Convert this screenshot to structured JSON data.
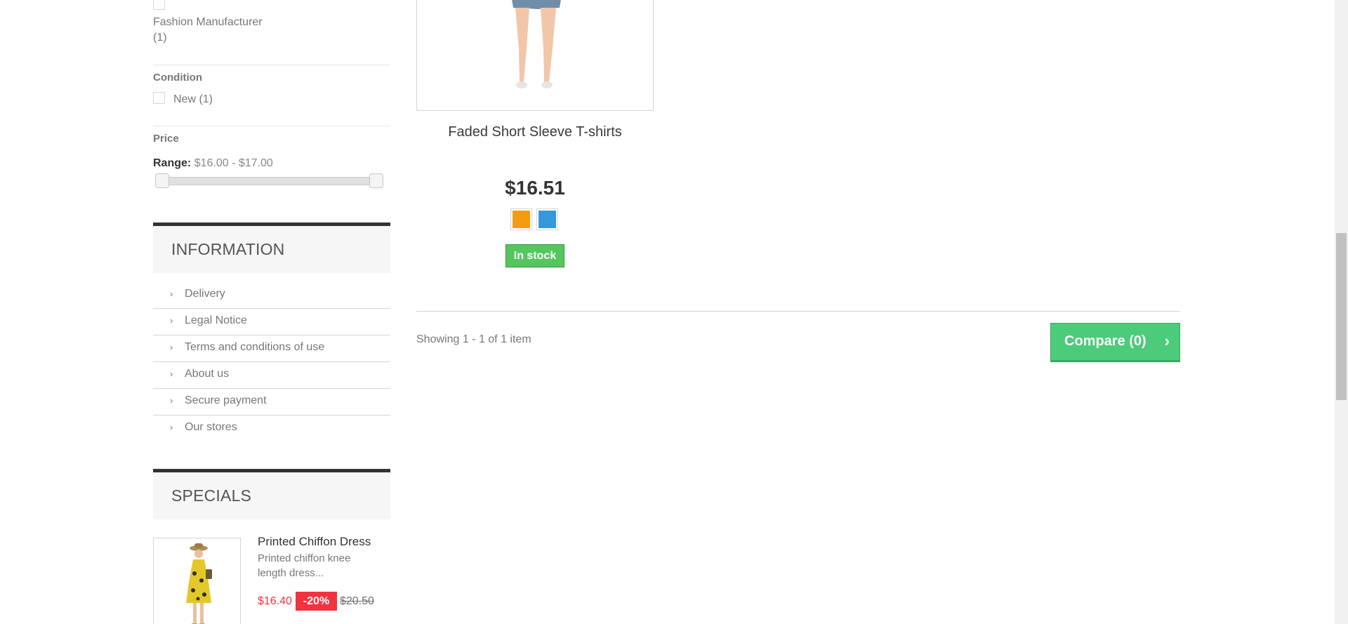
{
  "filters": {
    "manufacturer": {
      "option_label": "Fashion Manufacturer",
      "option_count": "(1)"
    },
    "condition": {
      "title": "Condition",
      "option_label": "New (1)"
    },
    "price": {
      "title": "Price",
      "range_label": "Range:",
      "range_value": "$16.00 - $17.00"
    }
  },
  "information": {
    "title": "INFORMATION",
    "items": [
      {
        "label": "Delivery"
      },
      {
        "label": "Legal Notice"
      },
      {
        "label": "Terms and conditions of use"
      },
      {
        "label": "About us"
      },
      {
        "label": "Secure payment"
      },
      {
        "label": "Our stores"
      }
    ],
    "chevron": "›"
  },
  "specials": {
    "title": "SPECIALS",
    "product": {
      "name": "Printed Chiffon Dress",
      "description": "Printed chiffon knee length dress...",
      "price": "$16.40",
      "reduction": "-20%",
      "old_price": "$20.50"
    }
  },
  "product": {
    "name": "Faded Short Sleeve T-shirts",
    "price": "$16.51",
    "swatches": [
      {
        "name": "Orange",
        "color": "#f39c11"
      },
      {
        "name": "Blue",
        "color": "#3498db"
      }
    ],
    "availability": "In stock"
  },
  "listing": {
    "showing": "Showing 1 - 1 of 1 item"
  },
  "compare": {
    "label": "Compare (0)",
    "chevron": "›"
  }
}
